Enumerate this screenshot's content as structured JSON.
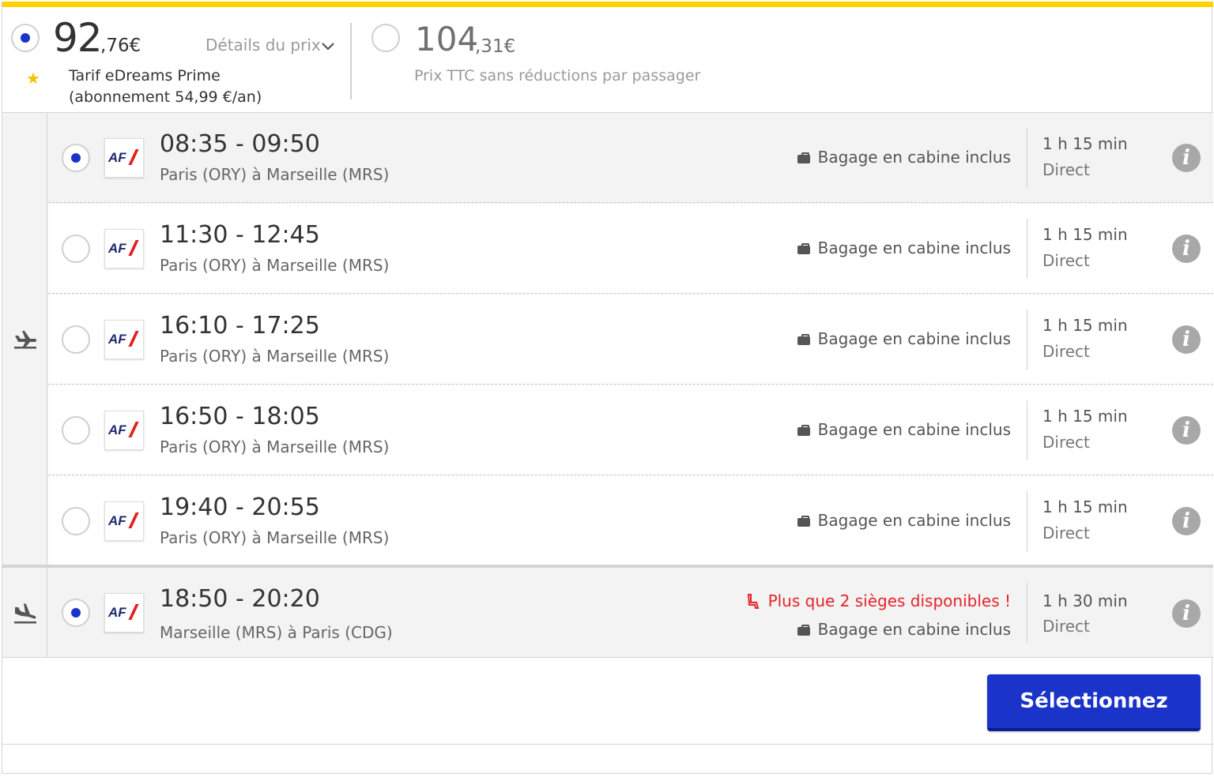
{
  "price": {
    "prime_int": "92",
    "prime_dec": ",76€",
    "details_label": "Détails du prix",
    "prime_label_line1": "Tarif eDreams Prime",
    "prime_label_line2": "(abonnement 54,99 €/an)",
    "standard_int": "104",
    "standard_dec": ",31€",
    "standard_label": "Prix TTC sans réductions par passager"
  },
  "outbound": {
    "flights": [
      {
        "time": "08:35 - 09:50",
        "route": "Paris (ORY) à Marseille (MRS)",
        "baggage": "Bagage en cabine inclus",
        "duration": "1 h 15 min",
        "stops": "Direct",
        "airline": "AF",
        "selected": true
      },
      {
        "time": "11:30 - 12:45",
        "route": "Paris (ORY) à Marseille (MRS)",
        "baggage": "Bagage en cabine inclus",
        "duration": "1 h 15 min",
        "stops": "Direct",
        "airline": "AF",
        "selected": false
      },
      {
        "time": "16:10 - 17:25",
        "route": "Paris (ORY) à Marseille (MRS)",
        "baggage": "Bagage en cabine inclus",
        "duration": "1 h 15 min",
        "stops": "Direct",
        "airline": "AF",
        "selected": false
      },
      {
        "time": "16:50 - 18:05",
        "route": "Paris (ORY) à Marseille (MRS)",
        "baggage": "Bagage en cabine inclus",
        "duration": "1 h 15 min",
        "stops": "Direct",
        "airline": "AF",
        "selected": false
      },
      {
        "time": "19:40 - 20:55",
        "route": "Paris (ORY) à Marseille (MRS)",
        "baggage": "Bagage en cabine inclus",
        "duration": "1 h 15 min",
        "stops": "Direct",
        "airline": "AF",
        "selected": false
      }
    ]
  },
  "inbound": {
    "flight": {
      "time": "18:50 - 20:20",
      "route": "Marseille (MRS) à Paris (CDG)",
      "seats_warning": "Plus que 2 sièges disponibles !",
      "baggage": "Bagage en cabine inclus",
      "duration": "1 h 30 min",
      "stops": "Direct",
      "airline": "AF",
      "selected": true
    }
  },
  "actions": {
    "select_label": "Sélectionnez"
  },
  "icons": {
    "info": "i",
    "star": "★"
  },
  "colors": {
    "accent_yellow": "#ffd200",
    "primary_blue": "#1a33c9",
    "warning_red": "#e5242d"
  }
}
